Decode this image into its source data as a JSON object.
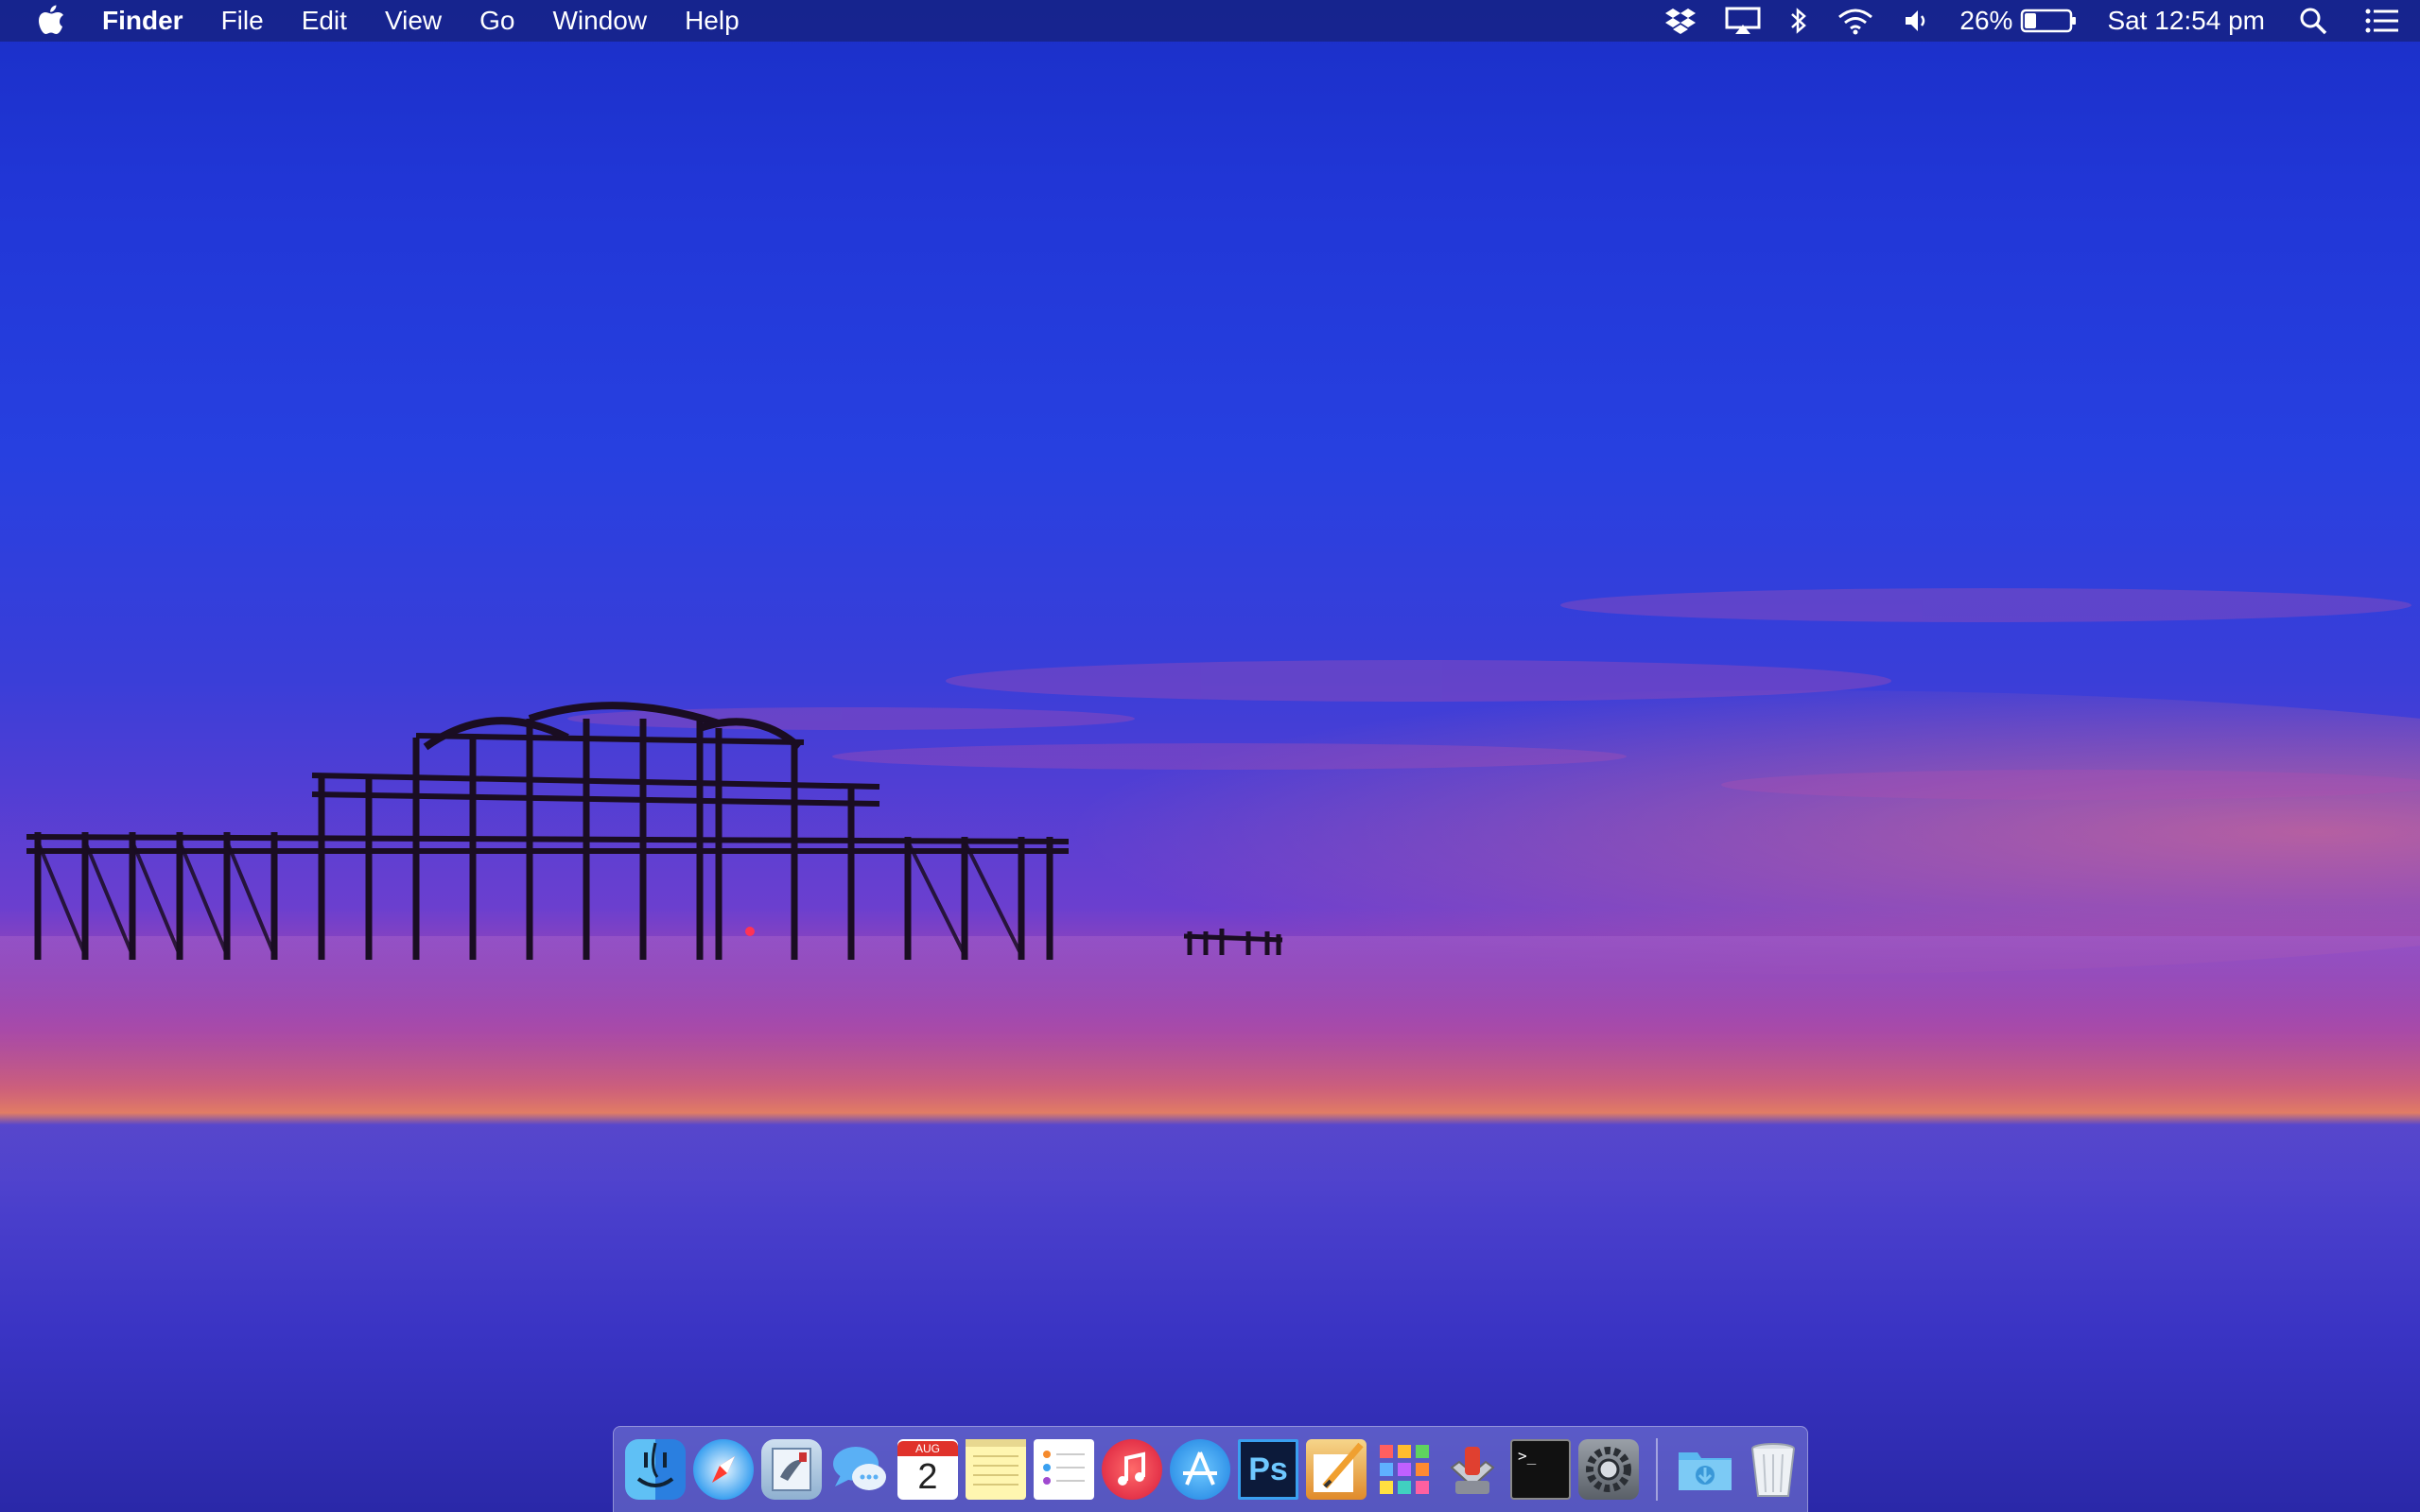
{
  "menubar": {
    "app_name": "Finder",
    "menus": [
      "File",
      "Edit",
      "View",
      "Go",
      "Window",
      "Help"
    ],
    "battery_percent_label": "26%",
    "battery_level": 0.26,
    "clock": "Sat 12:54 pm"
  },
  "status_icons": [
    "dropbox-icon",
    "airplay-icon",
    "bluetooth-icon",
    "wifi-icon",
    "volume-icon",
    "battery-icon",
    "spotlight-search-icon",
    "notification-center-icon"
  ],
  "dock": {
    "apps": [
      {
        "name": "Finder",
        "icon": "finder-icon"
      },
      {
        "name": "Safari",
        "icon": "safari-icon"
      },
      {
        "name": "Mail",
        "icon": "mail-icon"
      },
      {
        "name": "Messages",
        "icon": "messages-icon"
      },
      {
        "name": "Calendar",
        "icon": "calendar-icon",
        "month": "AUG",
        "day": "2"
      },
      {
        "name": "Notes",
        "icon": "notes-icon"
      },
      {
        "name": "Reminders",
        "icon": "reminders-icon"
      },
      {
        "name": "iTunes",
        "icon": "itunes-icon"
      },
      {
        "name": "App Store",
        "icon": "app-store-icon"
      },
      {
        "name": "Photoshop",
        "icon": "photoshop-icon",
        "label": "Ps"
      },
      {
        "name": "Pages",
        "icon": "pages-icon"
      },
      {
        "name": "Launchpad",
        "icon": "launchpad-icon"
      },
      {
        "name": "Transmit",
        "icon": "transmit-icon"
      },
      {
        "name": "Terminal",
        "icon": "terminal-icon",
        "label": ">_"
      },
      {
        "name": "System Preferences",
        "icon": "system-preferences-icon"
      }
    ],
    "stacks": [
      {
        "name": "Downloads",
        "icon": "downloads-folder-icon"
      },
      {
        "name": "Trash",
        "icon": "trash-icon"
      }
    ]
  },
  "colors": {
    "menubar_text": "#ffffff",
    "sky_top": "#1a2fc7",
    "horizon": "#ff8a55",
    "water": "#3a34c4"
  }
}
